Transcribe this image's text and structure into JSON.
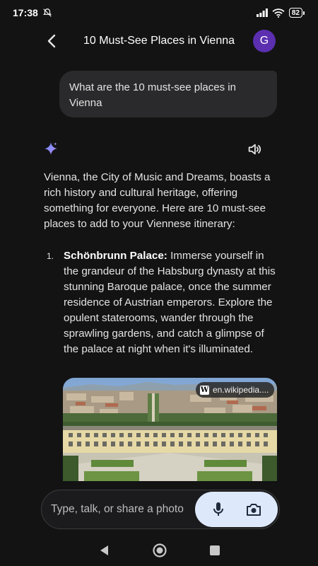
{
  "status": {
    "time": "17:38",
    "battery": "82"
  },
  "header": {
    "title": "10 Must-See Places in Vienna",
    "avatar_letter": "G"
  },
  "user_message": "What are the 10 must-see places in Vienna",
  "response": {
    "intro": "Vienna, the City of Music and Dreams, boasts a rich history and cultural heritage, offering something for everyone. Here are 10 must-see places to add to your Viennese itinerary:",
    "items": [
      {
        "number": "1.",
        "title": "Schönbrunn Palace:",
        "text": " Immerse yourself in the grandeur of the Habsburg dynasty at this stunning Baroque palace, once the summer residence of Austrian emperors. Explore the opulent staterooms, wander through the sprawling gardens, and catch a glimpse of the palace at night when it's illuminated."
      }
    ],
    "image": {
      "source": "en.wikipedia...."
    }
  },
  "composer": {
    "placeholder": "Type, talk, or share a photo"
  },
  "icons": {
    "back": "back-arrow-icon",
    "sparkle": "gemini-sparkle-icon",
    "speaker": "speaker-icon",
    "mic": "mic-icon",
    "camera": "camera-icon",
    "wiki": "wikipedia-icon"
  },
  "colors": {
    "background": "#131314",
    "bubble": "#2a2a2c",
    "avatar": "#5b2fb0",
    "pill": "#dde8fb"
  }
}
